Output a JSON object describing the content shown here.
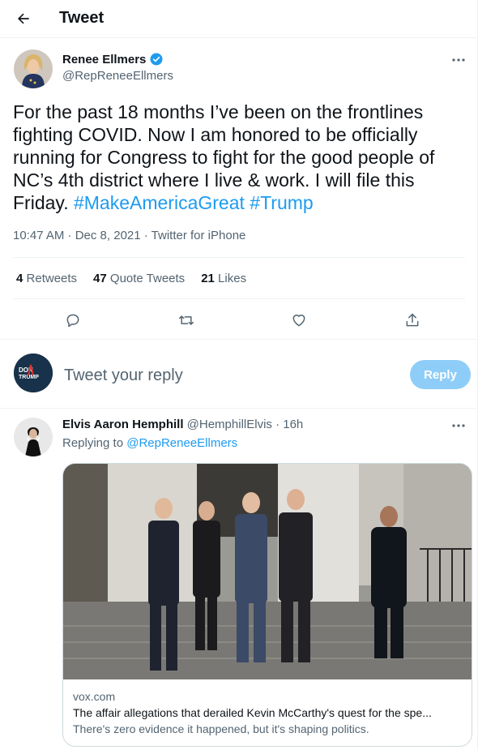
{
  "header": {
    "title": "Tweet"
  },
  "tweet": {
    "author_name": "Renee Ellmers",
    "author_handle": "@RepReneeEllmers",
    "text_plain": "For the past 18 months I’ve been on the frontlines fighting COVID. Now I am honored to be officially running for Congress to fight for the good people of NC’s 4th district where I live & work.  I will file this Friday. ",
    "hashtag_1": "#MakeAmericaGreat",
    "hashtag_2": "#Trump",
    "timestamp": "10:47 AM · Dec 8, 2021 · Twitter for iPhone",
    "stats": {
      "retweets_count": "4",
      "retweets_label": "Retweets",
      "quotes_count": "47",
      "quotes_label": "Quote Tweets",
      "likes_count": "21",
      "likes_label": "Likes"
    },
    "actions": [
      "reply-icon",
      "retweet-icon",
      "like-icon",
      "share-icon"
    ]
  },
  "composer": {
    "placeholder": "Tweet your reply",
    "button_label": "Reply",
    "avatar_text_top": "DON",
    "avatar_text_bottom": "TRUMP"
  },
  "reply": {
    "author_name": "Elvis Aaron Hemphill",
    "author_handle_time": "@HemphillElvis · 16h",
    "replying_prefix": "Replying to ",
    "replying_to": "@RepReneeEllmers",
    "card": {
      "domain": "vox.com",
      "title": "The affair allegations that derailed Kevin McCarthy's quest for the spe...",
      "description": "There's zero evidence it happened, but it's shaping politics."
    }
  },
  "colors": {
    "accent": "#1d9bf0",
    "reply_button": "#8ecdf8",
    "muted": "#536471",
    "verified": "#1d9bf0"
  }
}
